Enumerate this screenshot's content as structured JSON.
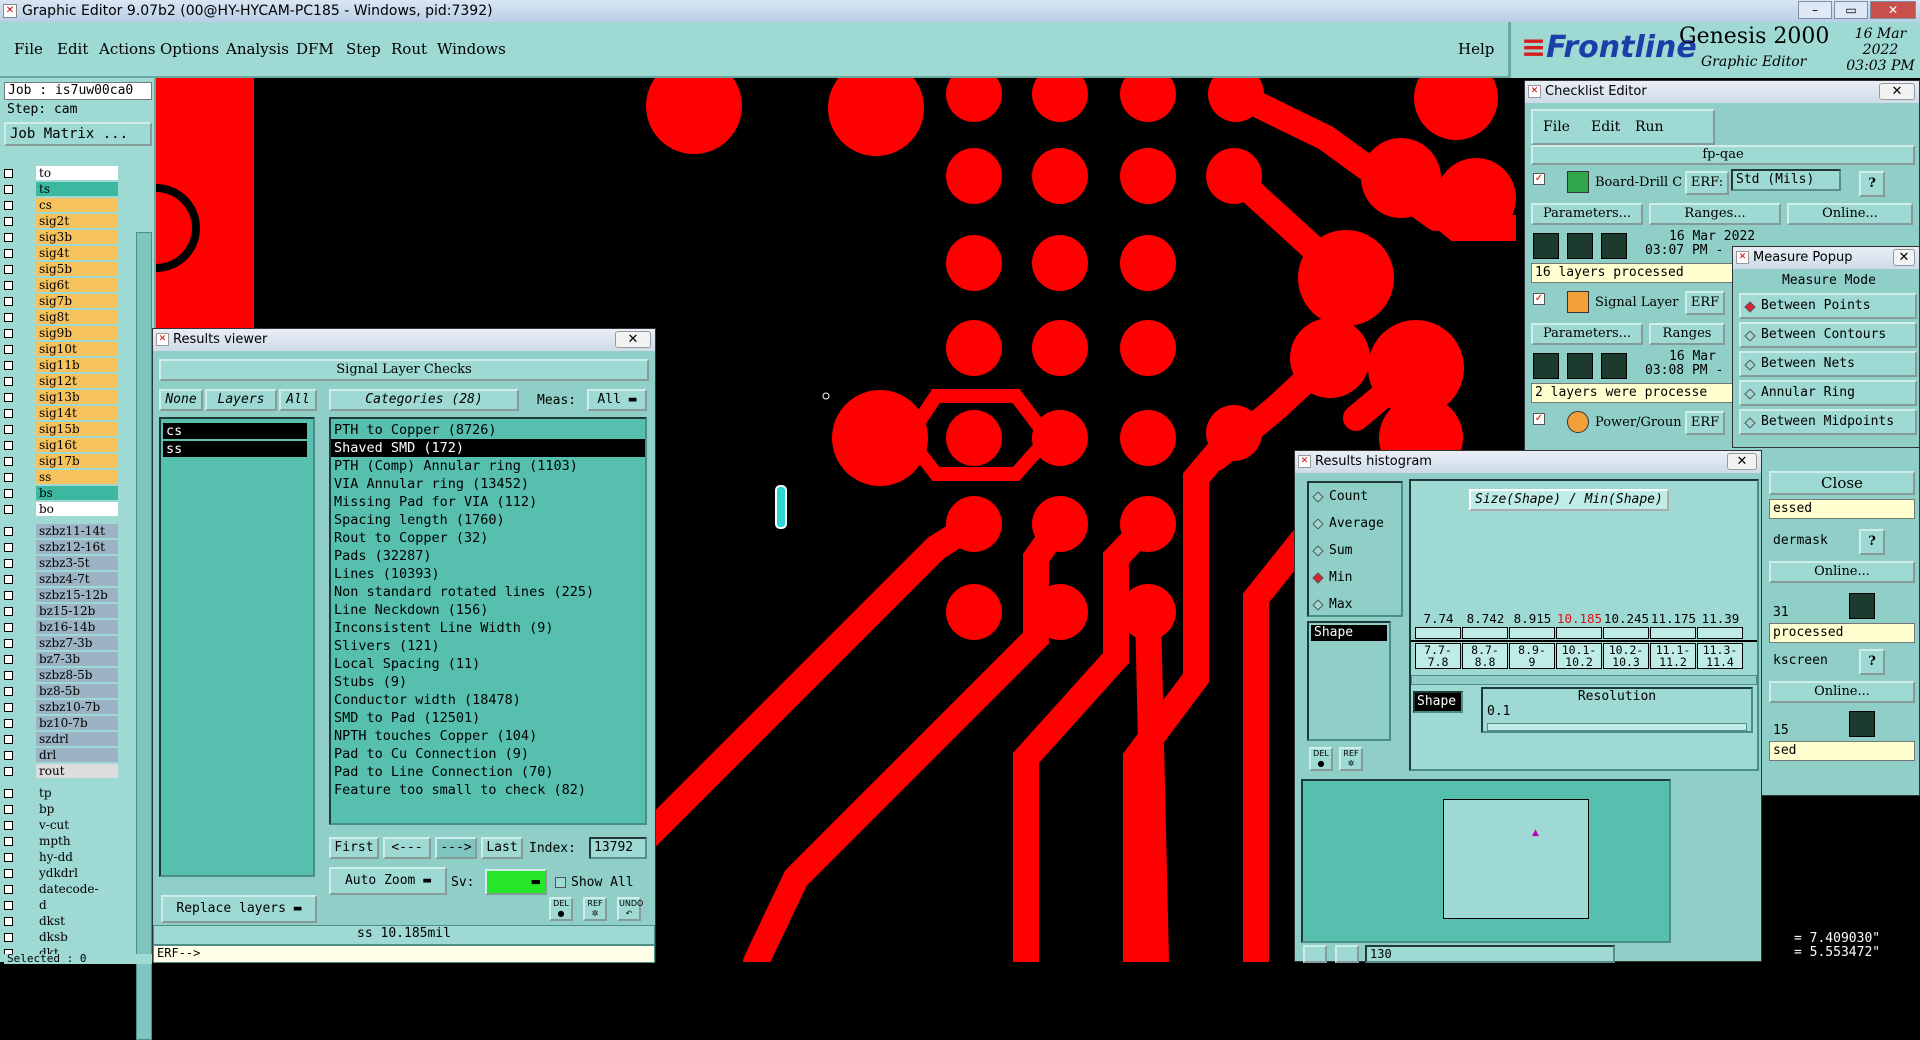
{
  "window": {
    "title": "Graphic Editor 9.07b2 (00@HY-HYCAM-PC185 - Windows, pid:7392)"
  },
  "menus": [
    "File",
    "Edit",
    "Actions",
    "Options",
    "Analysis",
    "DFM",
    "Step",
    "Rout",
    "Windows"
  ],
  "help": "Help",
  "brand": {
    "logo": "Frontline",
    "product": "Genesis 2000",
    "subtitle": "Graphic Editor",
    "date": "16 Mar 2022",
    "time": "03:03 PM"
  },
  "left": {
    "job": "Job : is7uw00ca0",
    "step": "Step: cam",
    "job_matrix": "Job Matrix ...",
    "layers_top": [
      "to",
      "ts",
      "cs",
      "sig2t",
      "sig3b",
      "sig4t",
      "sig5b",
      "sig6t",
      "sig7b",
      "sig8t",
      "sig9b",
      "sig10t",
      "sig11b",
      "sig12t",
      "sig13b",
      "sig14t",
      "sig15b",
      "sig16t",
      "sig17b",
      "ss",
      "bs",
      "bo"
    ],
    "layers_mid": [
      "szbz11-14t",
      "szbz12-16t",
      "szbz3-5t",
      "szbz4-7t",
      "szbz15-12b",
      "bz15-12b",
      "bz16-14b",
      "szbz7-3b",
      "bz7-3b",
      "szbz8-5b",
      "bz8-5b",
      "szbz10-7b",
      "bz10-7b",
      "szdrl",
      "drl",
      "rout"
    ],
    "layers_bot": [
      "tp",
      "bp",
      "v-cut",
      "mpth",
      "hy-dd",
      "ydkdrl",
      "datecode-pte",
      "d",
      "dkst",
      "dksb",
      "dkt"
    ],
    "selected": "Selected : 0"
  },
  "results_viewer": {
    "title": "Results viewer",
    "header": "Signal Layer Checks",
    "none": "None",
    "layers": "Layers",
    "all": "All",
    "categories_label": "Categories (28)",
    "meas_label": "Meas:",
    "meas_value": "All",
    "layer_items": [
      "cs",
      "ss"
    ],
    "categories": [
      "PTH to Copper (8726)",
      "Shaved SMD (172)",
      "PTH (Comp) Annular ring (1103)",
      "VIA Annular ring (13452)",
      "Missing Pad for VIA (112)",
      "Spacing length (1760)",
      "Rout to Copper (32)",
      "Pads (32287)",
      "Lines (10393)",
      "Non standard rotated lines (225)",
      "Line Neckdown (156)",
      "Inconsistent Line Width (9)",
      "Slivers (121)",
      "Local Spacing (11)",
      "Stubs (9)",
      "Conductor width (18478)",
      "SMD to Pad (12501)",
      "NPTH touches Copper (104)",
      "Pad to Cu Connection (9)",
      "Pad to Line Connection (70)",
      "Feature too small to check (82)"
    ],
    "first": "First",
    "prev": "<---",
    "next": "--->",
    "last": "Last",
    "index_label": "Index:",
    "index_value": "13792",
    "auto_zoom": "Auto Zoom",
    "sv_label": "Sv:",
    "show_all": "Show All",
    "replace_layers": "Replace layers",
    "status": "ss 10.185mil",
    "erf": "ERF-->"
  },
  "checklist": {
    "title": "Checklist Editor",
    "menus": [
      "File",
      "Edit",
      "Run"
    ],
    "name": "fp-qae",
    "checks": [
      {
        "name": "Board-Drill Che",
        "erf": "ERF:",
        "erf_value": "Std (Mils)",
        "date": "16 Mar 2022",
        "time": "03:07 PM -",
        "status": "16 layers processed"
      },
      {
        "name": "Signal Layer Ch",
        "erf": "ERF",
        "date": "16 Mar",
        "time": "03:08 PM -",
        "status": "2 layers were processe"
      },
      {
        "name": "Power/Ground C",
        "erf": "ERF"
      }
    ],
    "params": "Parameters...",
    "ranges": "Ranges...",
    "ranges_short": "Ranges",
    "online": "Online...",
    "close": "Close",
    "partial": [
      "essed",
      "dermask",
      "Online...",
      "31",
      "processed",
      "kscreen",
      "Online...",
      "15",
      "sed"
    ],
    "coords": [
      "= 7.409030\"",
      "= 5.553472\""
    ]
  },
  "measure_popup": {
    "title": "Measure Popup",
    "mode_label": "Measure Mode",
    "modes": [
      "Between Points",
      "Between Contours",
      "Between Nets",
      "Annular Ring",
      "Between Midpoints"
    ]
  },
  "histogram": {
    "title": "Results histogram",
    "options": [
      "Count",
      "Average",
      "Sum",
      "Min",
      "Max"
    ],
    "selected_option": "Min",
    "attr": "Shape",
    "caption": "Size(Shape) / Min(Shape)",
    "bins": [
      {
        "value": "7.74",
        "range": [
          "7.7-",
          "7.8"
        ]
      },
      {
        "value": "8.742",
        "range": [
          "8.7-",
          "8.8"
        ]
      },
      {
        "value": "8.915",
        "range": [
          "8.9-",
          "9"
        ]
      },
      {
        "value": "10.185",
        "range": [
          "10.1-",
          "10.2"
        ]
      },
      {
        "value": "10.245",
        "range": [
          "10.2-",
          "10.3"
        ]
      },
      {
        "value": "11.175",
        "range": [
          "11.1-",
          "11.2"
        ]
      },
      {
        "value": "11.39",
        "range": [
          "11.3-",
          "11.4"
        ]
      }
    ],
    "highlight_color": "#e01010",
    "resolution_label": "Resolution",
    "resolution_value": "0.1",
    "shape2": "Shape",
    "bottom_field": "130"
  },
  "colors": {
    "panel": "#9fd9d3",
    "list": "#57bfae",
    "copper": "#ff0000",
    "accent": "#1a3fa8"
  }
}
